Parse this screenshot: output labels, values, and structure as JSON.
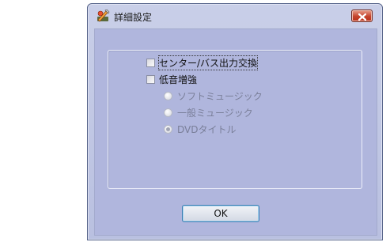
{
  "dialog": {
    "title": "詳細設定",
    "icon": "settings-tools-icon",
    "close_icon": "close-icon"
  },
  "options": {
    "center_bass_swap": {
      "label": "センター/バス出力交換",
      "checked": false
    },
    "bass_boost": {
      "label": "低音増強",
      "checked": false
    },
    "radios": [
      {
        "label": "ソフトミュージック",
        "selected": false,
        "enabled": false
      },
      {
        "label": "一般ミュージック",
        "selected": false,
        "enabled": false
      },
      {
        "label": "DVDタイトル",
        "selected": true,
        "enabled": false
      }
    ]
  },
  "buttons": {
    "ok_label": "OK"
  },
  "colors": {
    "close_button": "#c4432c",
    "client_background": "#b0b6dd",
    "disabled_text": "#7a7f99"
  }
}
